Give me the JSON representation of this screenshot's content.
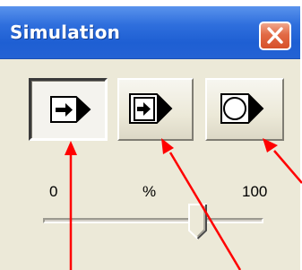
{
  "window": {
    "title": "Simulation",
    "close_icon": "close-x-icon",
    "accent": "#2462d4",
    "close_color": "#d6512a"
  },
  "toolbar": {
    "buttons": [
      {
        "icon": "step-forward-icon",
        "pressed": true
      },
      {
        "icon": "run-to-end-icon",
        "pressed": false
      },
      {
        "icon": "loop-play-icon",
        "pressed": false
      }
    ]
  },
  "speed": {
    "min_label": "0",
    "unit_label": "%",
    "max_label": "100",
    "value_percent": 74
  },
  "annotations": {
    "arrow_color": "#ff0000",
    "count": 3
  }
}
